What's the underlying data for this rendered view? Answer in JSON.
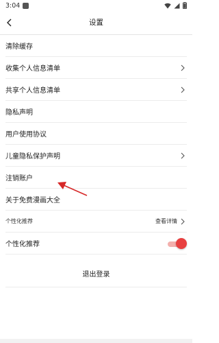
{
  "status_bar": {
    "time": "3:04"
  },
  "header": {
    "title": "设置"
  },
  "settings": {
    "clear_cache": "清除缓存",
    "collect_info_list": "收集个人信息清单",
    "share_info_list": "共享个人信息清单",
    "privacy_statement": "隐私声明",
    "user_agreement": "用户使用协议",
    "child_privacy": "儿童隐私保护声明",
    "cancel_account": "注销账户",
    "about": "关于免费漫画大全"
  },
  "personalization": {
    "section_title": "个性化推荐",
    "section_action": "查看详情",
    "toggle_label": "个性化推荐",
    "toggle_on": true
  },
  "logout": {
    "label": "退出登录"
  },
  "colors": {
    "accent": "#e84040",
    "annotation_arrow": "#d62828"
  }
}
